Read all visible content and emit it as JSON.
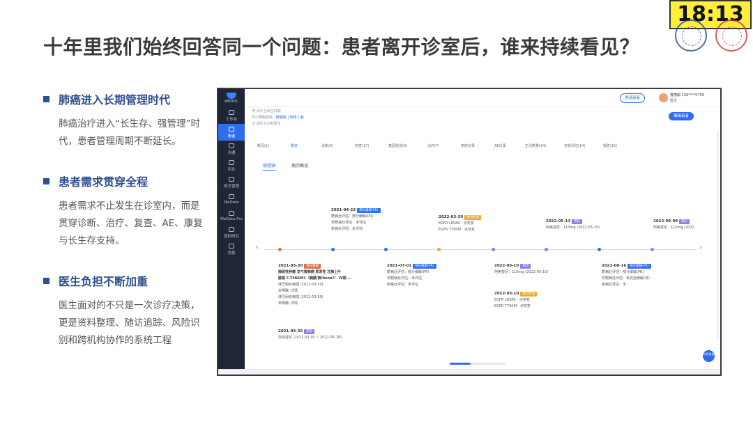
{
  "slide": {
    "title": "十年里我们始终回答同一个问题：患者离开诊室后，谁来持续看见？",
    "clock": "18:13"
  },
  "sections": [
    {
      "title": "肺癌进入长期管理时代",
      "body": "肺癌治疗进入“长生存、强管理”时代，患者管理周期不断延长。"
    },
    {
      "title": "患者需求贯穿全程",
      "body": "患者需求不止发生在诊室内，而是贯穿诊断、治疗、复查、AE、康复与长生存支持。"
    },
    {
      "title": "医生负担不断加重",
      "body": "医生面对的不只是一次诊疗决策，更是资料整理、随访追踪、风险识别和跨机构协作的系统工程"
    }
  ],
  "app": {
    "logo_text": "WEDOC",
    "nav": [
      {
        "label": "工作台"
      },
      {
        "label": "患者"
      },
      {
        "label": "沟通"
      },
      {
        "label": "问诊"
      },
      {
        "label": "处方管理"
      },
      {
        "label": "MeData"
      },
      {
        "label": "MeData Pro"
      },
      {
        "label": "我的研究"
      },
      {
        "label": "消息"
      }
    ],
    "topbar": {
      "invite_label": "邀请患者",
      "user_name": "曹丽娟 139****5759",
      "user_role": "医生"
    },
    "patient": {
      "line1": "男  请补全出生日期",
      "line2_label": "非小细胞肺癌",
      "line2_links": "肺腺癌 | 转移 | 脑",
      "line3": "汉 请补全诊断医生"
    },
    "primary_button": "编辑患者",
    "tabs": [
      "概况(1)",
      "概览",
      "诊断(5)",
      "检查(17)",
      "基因检测(9)",
      "治疗(7)",
      "用药记录",
      "AE记录",
      "生活质量(14)",
      "疗效评估(14)",
      "报告(15)"
    ],
    "subtabs": [
      "病程轴",
      "病历概览"
    ],
    "timeline": {
      "top_events": [
        {
          "date": "2021-04-22",
          "badge": "部分缓解(PR)",
          "lines": [
            "靶病灶评估：部分缓解(PR)",
            "非靶病灶评估：未评估",
            "新病灶评估：未评估"
          ]
        },
        {
          "date": "2022-03-30",
          "badge": "基因检测",
          "lines": [
            "EGFR L858R：点突变",
            "EGFR T790M：点突变"
          ]
        },
        {
          "date": "2022-05-13",
          "badge": "用药",
          "lines": [
            "阿美替尼：110mg (2022-05-19)"
          ]
        },
        {
          "date": "2022-09-08",
          "badge": "部分",
          "lines": [
            "阿美替尼：110mg (2022"
          ]
        }
      ],
      "bottom_events": [
        {
          "date": "2021-03-30",
          "badge": "部分缓解",
          "lines": [
            "肺恶性肿瘤 支气管肺癌 原发性 左肺上叶",
            "腺癌 C-T4N1M1（胸膜/肺/bone?） IV期 ...",
            "淋巴组织病理 (2021-03-19)",
            "未明确 ·详情",
            "淋巴组织病理 (2021-03-19)",
            "未明确 ·详情"
          ]
        },
        {
          "date": "2021-03-30",
          "badge": "用药",
          "lines": [
            "埃克替尼 (2021-03-30 ~ 2022-05-18)"
          ]
        },
        {
          "date": "2021-07-01",
          "badge": "部分缓解(PR)",
          "lines": [
            "靶病灶评估：部分缓解(PR)",
            "非靶病灶评估：未评估",
            "新病灶评估：未评估"
          ]
        },
        {
          "date": "2022-05-10",
          "badge": "用药",
          "lines": [
            "阿美替尼：110mg (2022-05-10)"
          ]
        },
        {
          "date": "2022-03-10",
          "badge": "基因检测",
          "lines": [
            "EGFR L858R：点突变",
            "EGFR T790M：点突变"
          ]
        },
        {
          "date": "2022-08-16",
          "badge": "部分缓解(PR)",
          "lines": [
            "靶病灶评估：部分缓解(PR)",
            "非靶病灶评估：未完全缓解(非)",
            "新病灶评估：无"
          ]
        }
      ]
    },
    "float_button": "在线咨询"
  }
}
